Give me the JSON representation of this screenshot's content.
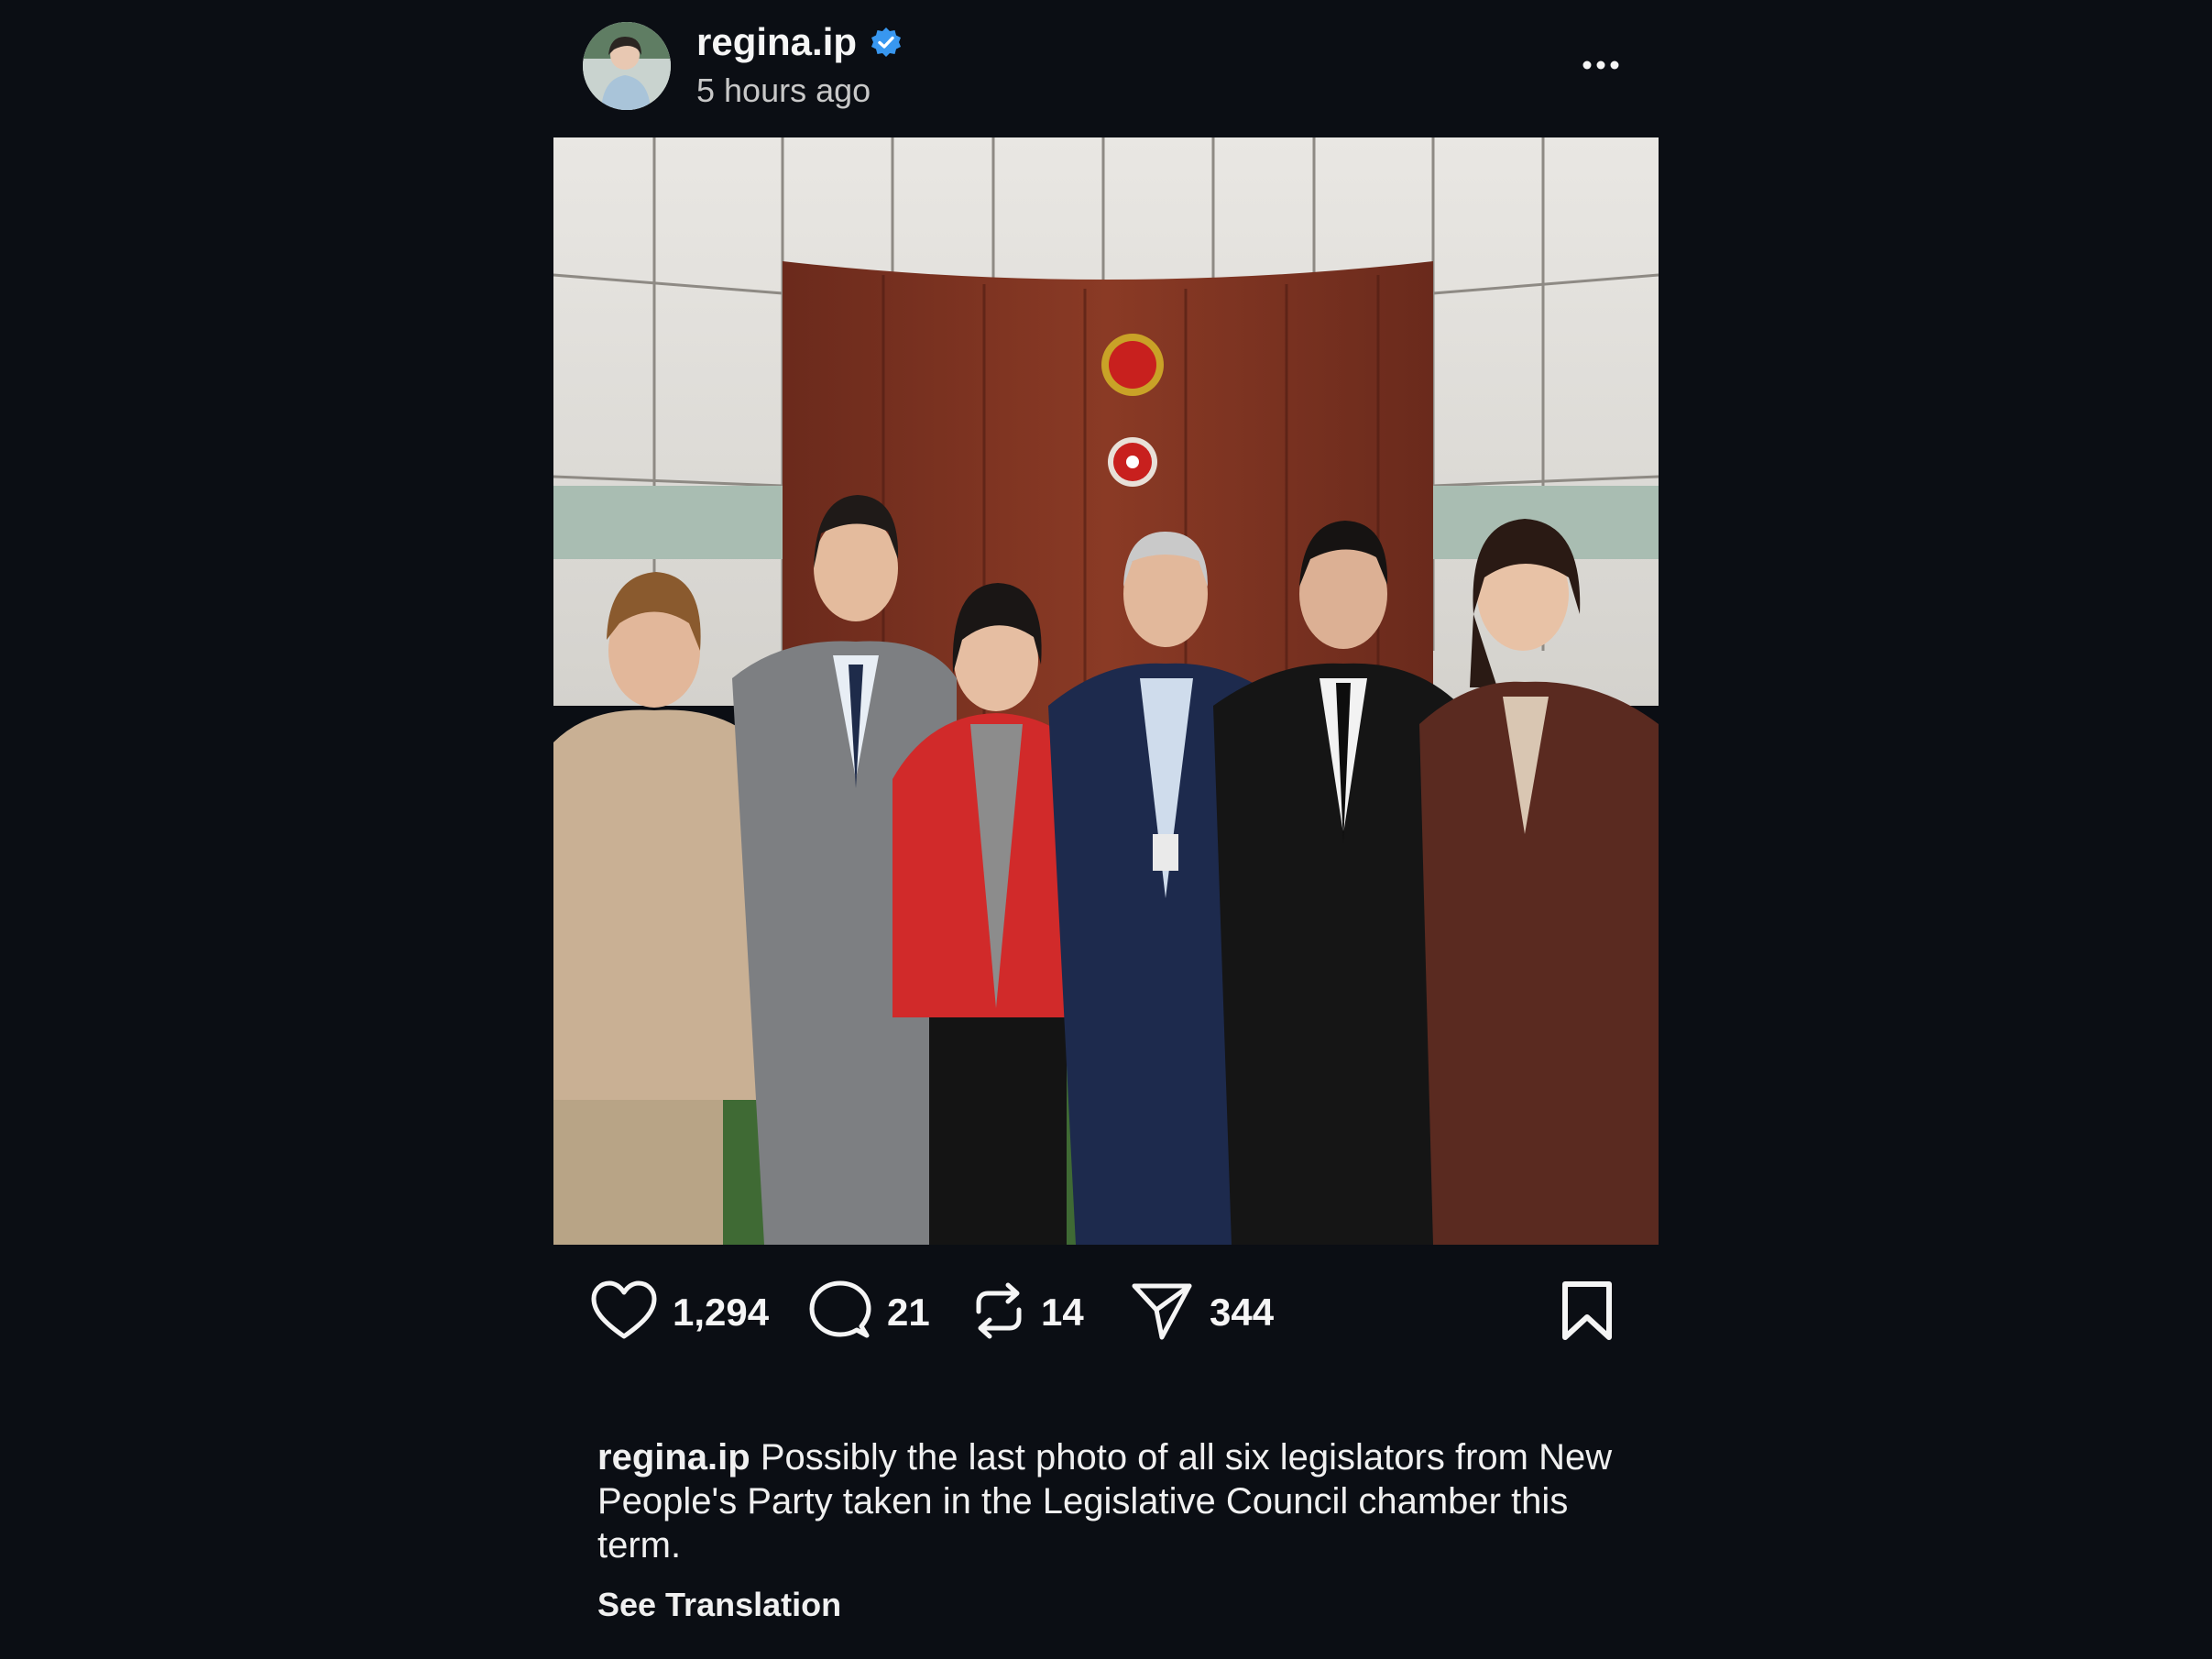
{
  "post": {
    "username": "regina.ip",
    "verified": true,
    "timestamp": "5 hours ago",
    "photo_alt": "",
    "actions": {
      "likes": "1,294",
      "comments": "21",
      "reposts": "14",
      "shares": "344"
    },
    "caption": {
      "username": "regina.ip",
      "text": "Possibly the  last photo of all six legislators from New People's Party taken in the Legislative Council chamber this term."
    },
    "see_translation": "See Translation"
  },
  "colors": {
    "background": "#0b0e14",
    "text": "#f5f5f5",
    "secondary_text": "#c8c8c8",
    "verified_badge": "#3897f0"
  },
  "icons": [
    "avatar",
    "verified-badge-icon",
    "more-options-icon",
    "heart-icon",
    "comment-icon",
    "repost-icon",
    "share-icon",
    "bookmark-icon"
  ]
}
